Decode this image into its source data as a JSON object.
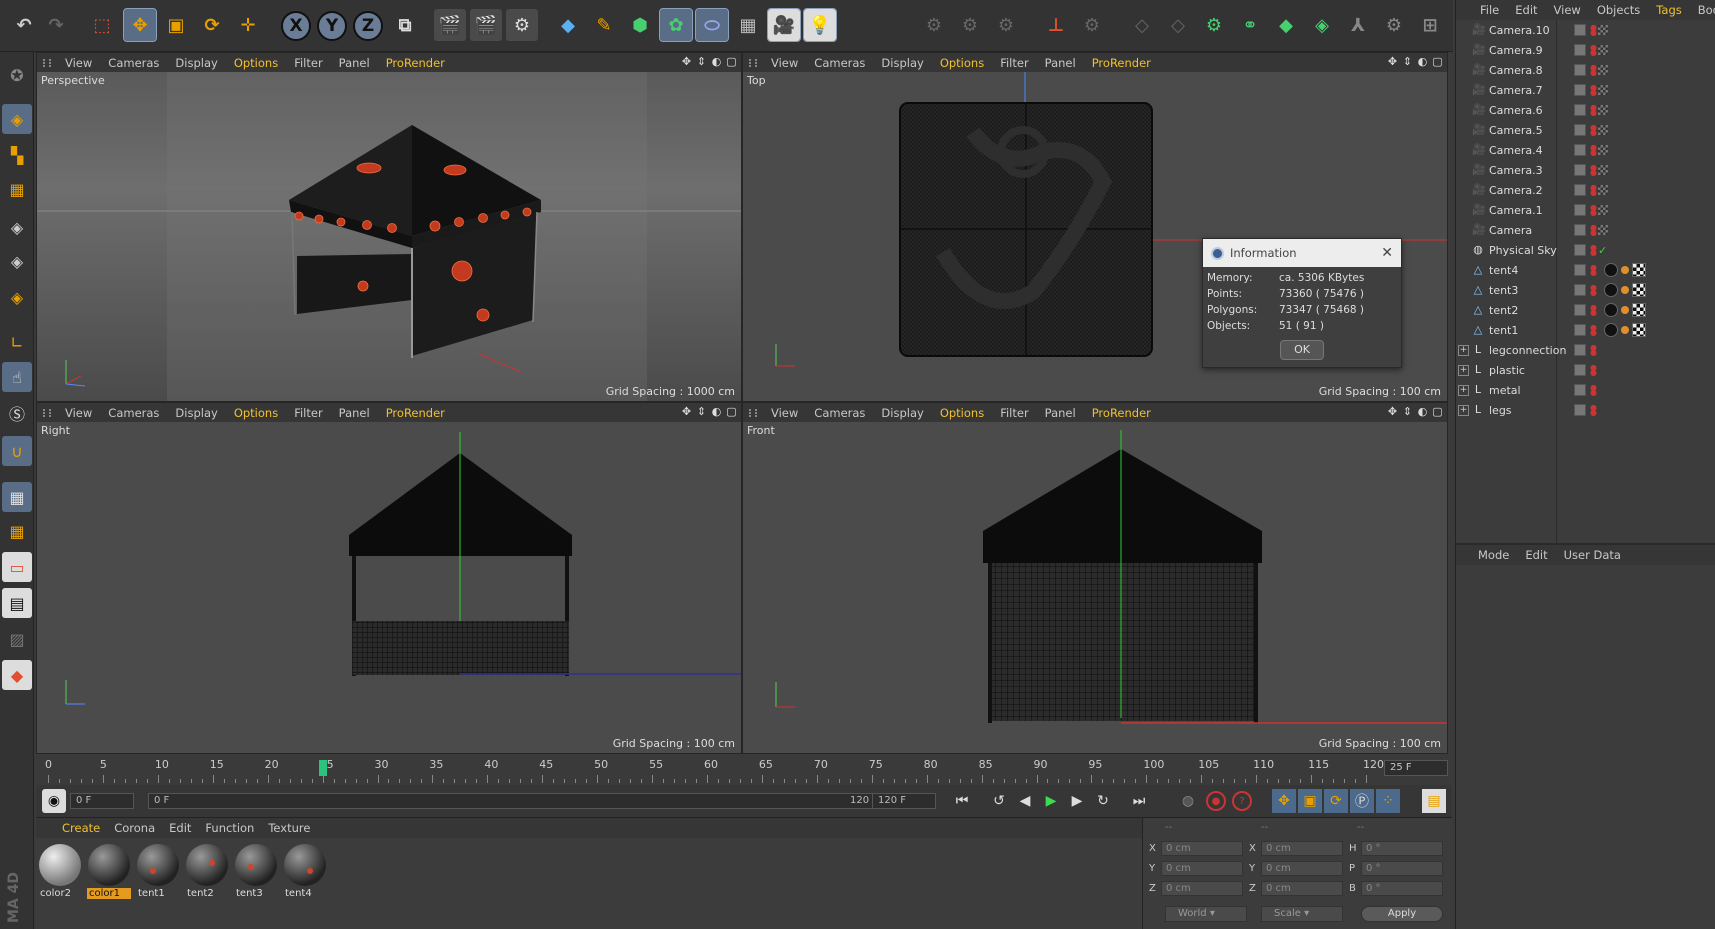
{
  "toolbar": {
    "icons": [
      "undo-icon",
      "redo-icon",
      "live-select-icon",
      "move-icon",
      "scale-icon",
      "rotate-icon",
      "new-object-icon",
      "x-axis-icon",
      "y-axis-icon",
      "z-axis-icon",
      "coordinate-system-icon",
      "render-view-icon",
      "render-picture-viewer-icon",
      "render-settings-icon",
      "cube-icon",
      "pen-icon",
      "subdivision-icon",
      "cloner-icon",
      "deformer-icon",
      "floor-icon",
      "camera-icon",
      "light-icon"
    ],
    "axis": {
      "x": "X",
      "y": "Y",
      "z": "Z"
    }
  },
  "viewport_menu": {
    "view": "View",
    "cameras": "Cameras",
    "display": "Display",
    "options": "Options",
    "filter": "Filter",
    "panel": "Panel",
    "prorender": "ProRender"
  },
  "viewports": [
    {
      "name": "Perspective",
      "grid": "Grid Spacing : 1000 cm"
    },
    {
      "name": "Top",
      "grid": "Grid Spacing : 100 cm"
    },
    {
      "name": "Right",
      "grid": "Grid Spacing : 100 cm"
    },
    {
      "name": "Front",
      "grid": "Grid Spacing : 100 cm"
    }
  ],
  "object_manager": {
    "menu": {
      "file": "File",
      "edit": "Edit",
      "view": "View",
      "objects": "Objects",
      "tags": "Tags",
      "bookmarks": "Bookma"
    },
    "items": [
      {
        "name": "Camera.10",
        "icon": "camera-icon"
      },
      {
        "name": "Camera.9",
        "icon": "camera-icon"
      },
      {
        "name": "Camera.8",
        "icon": "camera-icon"
      },
      {
        "name": "Camera.7",
        "icon": "camera-icon"
      },
      {
        "name": "Camera.6",
        "icon": "camera-icon"
      },
      {
        "name": "Camera.5",
        "icon": "camera-icon"
      },
      {
        "name": "Camera.4",
        "icon": "camera-icon"
      },
      {
        "name": "Camera.3",
        "icon": "camera-icon"
      },
      {
        "name": "Camera.2",
        "icon": "camera-icon"
      },
      {
        "name": "Camera.1",
        "icon": "camera-icon"
      },
      {
        "name": "Camera",
        "icon": "camera-icon"
      },
      {
        "name": "Physical Sky",
        "icon": "sky-icon"
      },
      {
        "name": "tent4",
        "icon": "polygon-object-icon"
      },
      {
        "name": "tent3",
        "icon": "polygon-object-icon"
      },
      {
        "name": "tent2",
        "icon": "polygon-object-icon"
      },
      {
        "name": "tent1",
        "icon": "polygon-object-icon"
      },
      {
        "name": "legconnection",
        "icon": "null-object-icon"
      },
      {
        "name": "plastic",
        "icon": "null-object-icon"
      },
      {
        "name": "metal",
        "icon": "null-object-icon"
      },
      {
        "name": "legs",
        "icon": "null-object-icon"
      }
    ]
  },
  "attribute_manager": {
    "menu": {
      "mode": "Mode",
      "edit": "Edit",
      "user_data": "User Data"
    }
  },
  "info_dialog": {
    "title": "Information",
    "memory_label": "Memory:",
    "memory_value": "ca. 5306 KBytes",
    "points_label": "Points:",
    "points_value": "73360 ( 75476 )",
    "polygons_label": "Polygons:",
    "polygons_value": "73347 ( 75468 )",
    "objects_label": "Objects:",
    "objects_value": "51 ( 91 )",
    "ok": "OK"
  },
  "timeline": {
    "ticks": [
      "0",
      "5",
      "10",
      "15",
      "20",
      "25",
      "30",
      "35",
      "40",
      "45",
      "50",
      "55",
      "60",
      "65",
      "70",
      "75",
      "80",
      "85",
      "90",
      "95",
      "100",
      "105",
      "110",
      "115",
      "120"
    ],
    "current_frame": 25,
    "end_frame_field": "25 F"
  },
  "transport": {
    "current": "0 F",
    "range_start": "0 F",
    "range_end": "120 F",
    "max": "120 F"
  },
  "material_manager": {
    "menu": {
      "create": "Create",
      "corona": "Corona",
      "edit": "Edit",
      "function": "Function",
      "texture": "Texture"
    },
    "materials": [
      "color2",
      "color1",
      "tent1",
      "tent2",
      "tent3",
      "tent4"
    ]
  },
  "coordinate_manager": {
    "header": [
      "--",
      "--",
      "--"
    ],
    "rows": [
      {
        "a": "X",
        "av": "0 cm",
        "b": "X",
        "bv": "0 cm",
        "c": "H",
        "cv": "0 °"
      },
      {
        "a": "Y",
        "av": "0 cm",
        "b": "Y",
        "bv": "0 cm",
        "c": "P",
        "cv": "0 °"
      },
      {
        "a": "Z",
        "av": "0 cm",
        "b": "Z",
        "bv": "0 cm",
        "c": "B",
        "cv": "0 °"
      }
    ],
    "space": "World",
    "mode": "Scale",
    "apply": "Apply"
  },
  "brand": "MA 4D"
}
